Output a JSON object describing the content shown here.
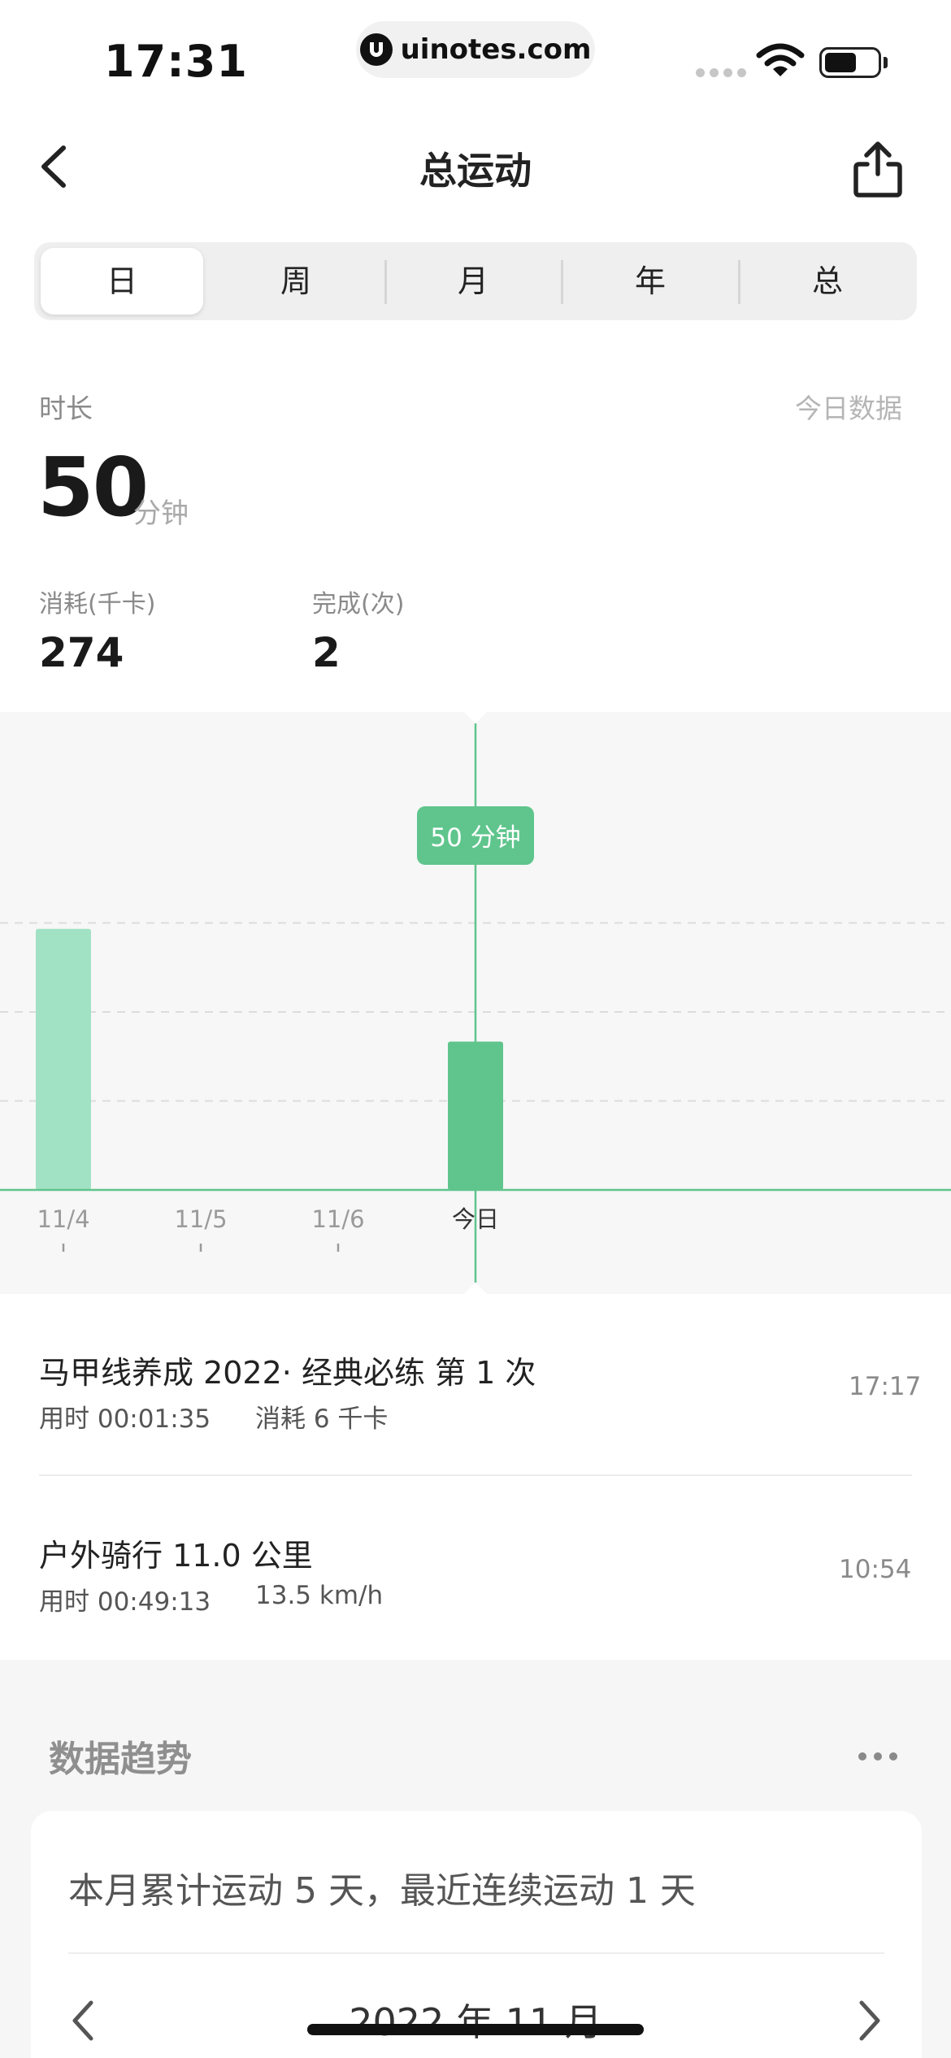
{
  "status_bar": {
    "time": "17:31",
    "url": "uinotes.com"
  },
  "header": {
    "title": "总运动"
  },
  "tabs": [
    {
      "label": "日",
      "active": true
    },
    {
      "label": "周",
      "active": false
    },
    {
      "label": "月",
      "active": false
    },
    {
      "label": "年",
      "active": false
    },
    {
      "label": "总",
      "active": false
    }
  ],
  "summary": {
    "duration_label": "时长",
    "today_label": "今日数据",
    "duration_value": "50",
    "duration_unit": "分钟",
    "calories_label": "消耗(千卡)",
    "calories_value": "274",
    "completed_label": "完成(次)",
    "completed_value": "2"
  },
  "chart_data": {
    "type": "bar",
    "categories": [
      "11/4",
      "11/5",
      "11/6",
      "今日"
    ],
    "values": [
      88,
      0,
      0,
      50
    ],
    "selected_index": 3,
    "tooltip": "50 分钟",
    "ylim": [
      0,
      120
    ],
    "grid": true,
    "colors": {
      "bar": "#a2e2c4",
      "selected_bar": "#5fc58c",
      "line": "#5fc58c",
      "tooltip": "#5fc58c"
    }
  },
  "records": [
    {
      "title": "马甲线养成 2022· 经典必练   第 1 次",
      "sub1": "用时 00:01:35",
      "sub2": "消耗 6 千卡",
      "time": "17:17"
    },
    {
      "title": "户外骑行 11.0 公里",
      "sub1": "用时 00:49:13",
      "sub2": "13.5 km/h",
      "time": "10:54"
    }
  ],
  "trend": {
    "title": "数据趋势",
    "summary": "本月累计运动 5 天，最近连续运动 1 天",
    "month": "2022 年 11 月"
  },
  "colors": {
    "accent": "#5fc58c",
    "accent_light": "#a2e2c4"
  }
}
